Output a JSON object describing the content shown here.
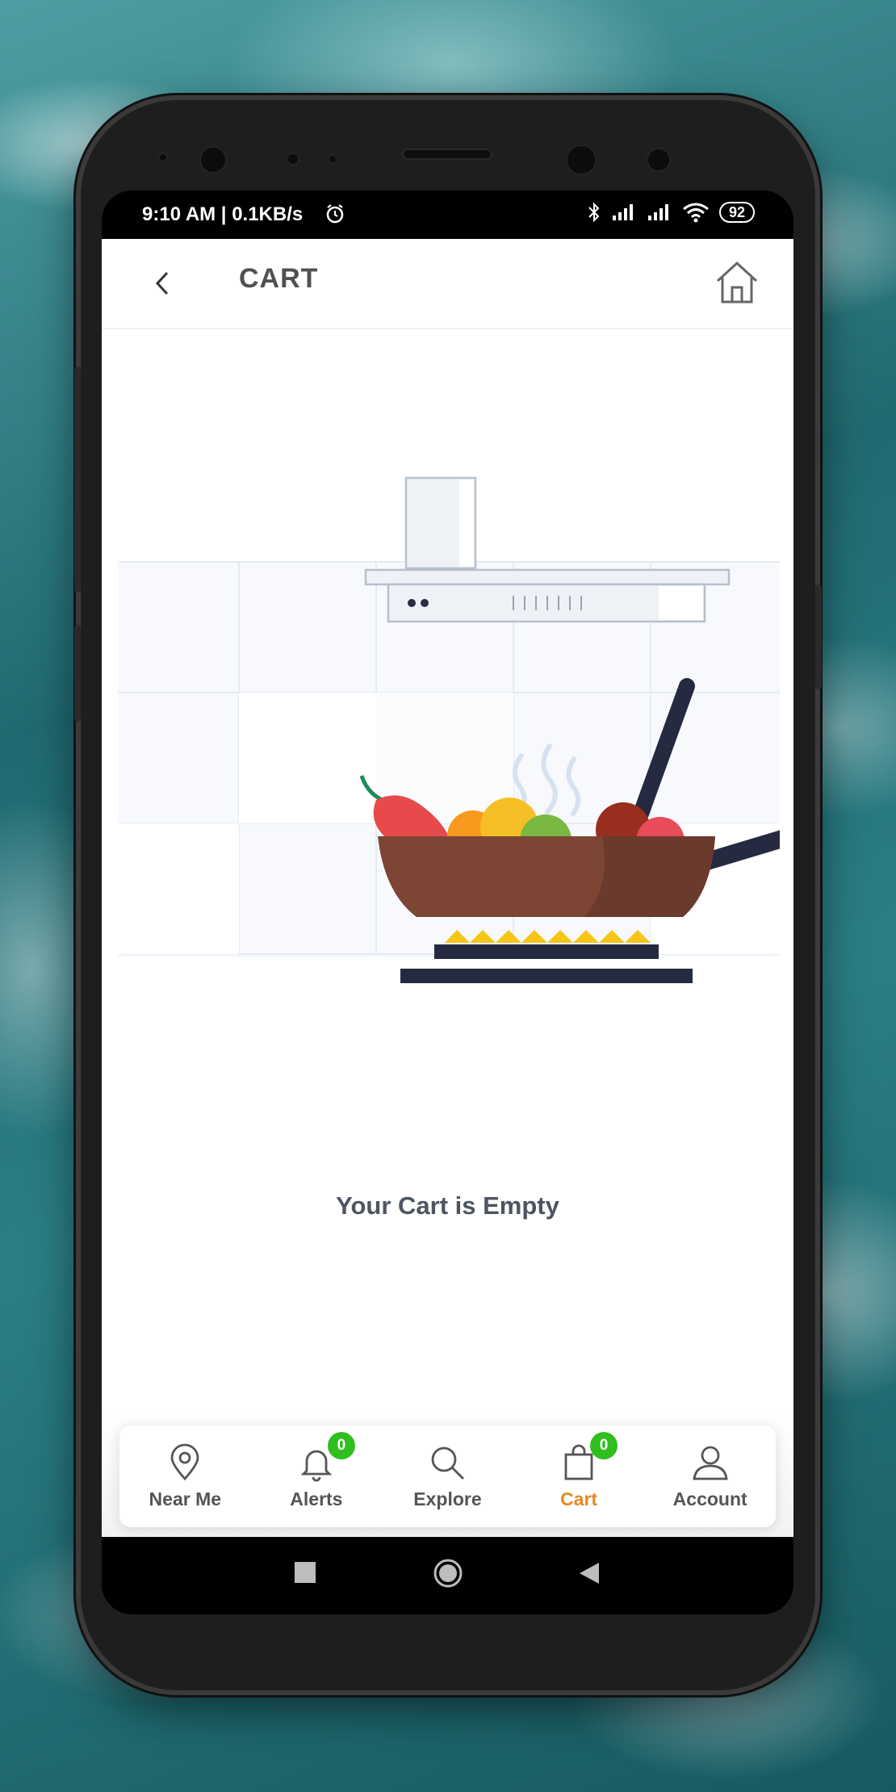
{
  "status_bar": {
    "time_and_speed": "9:10 AM | 0.1KB/s",
    "battery": "92"
  },
  "header": {
    "title": "CART",
    "back_icon": "chevron-left-icon",
    "home_icon": "home-icon"
  },
  "content": {
    "empty_message": "Your Cart is Empty"
  },
  "bottom_nav": {
    "items": [
      {
        "label": "Near Me",
        "icon": "map-pin-icon"
      },
      {
        "label": "Alerts",
        "icon": "bell-icon",
        "badge": "0"
      },
      {
        "label": "Explore",
        "icon": "search-icon"
      },
      {
        "label": "Cart",
        "icon": "bag-icon",
        "badge": "0",
        "active": true
      },
      {
        "label": "Account",
        "icon": "user-icon"
      }
    ]
  },
  "colors": {
    "accent": "#e8891f",
    "badge": "#2fbf1f",
    "text": "#4e5560"
  }
}
